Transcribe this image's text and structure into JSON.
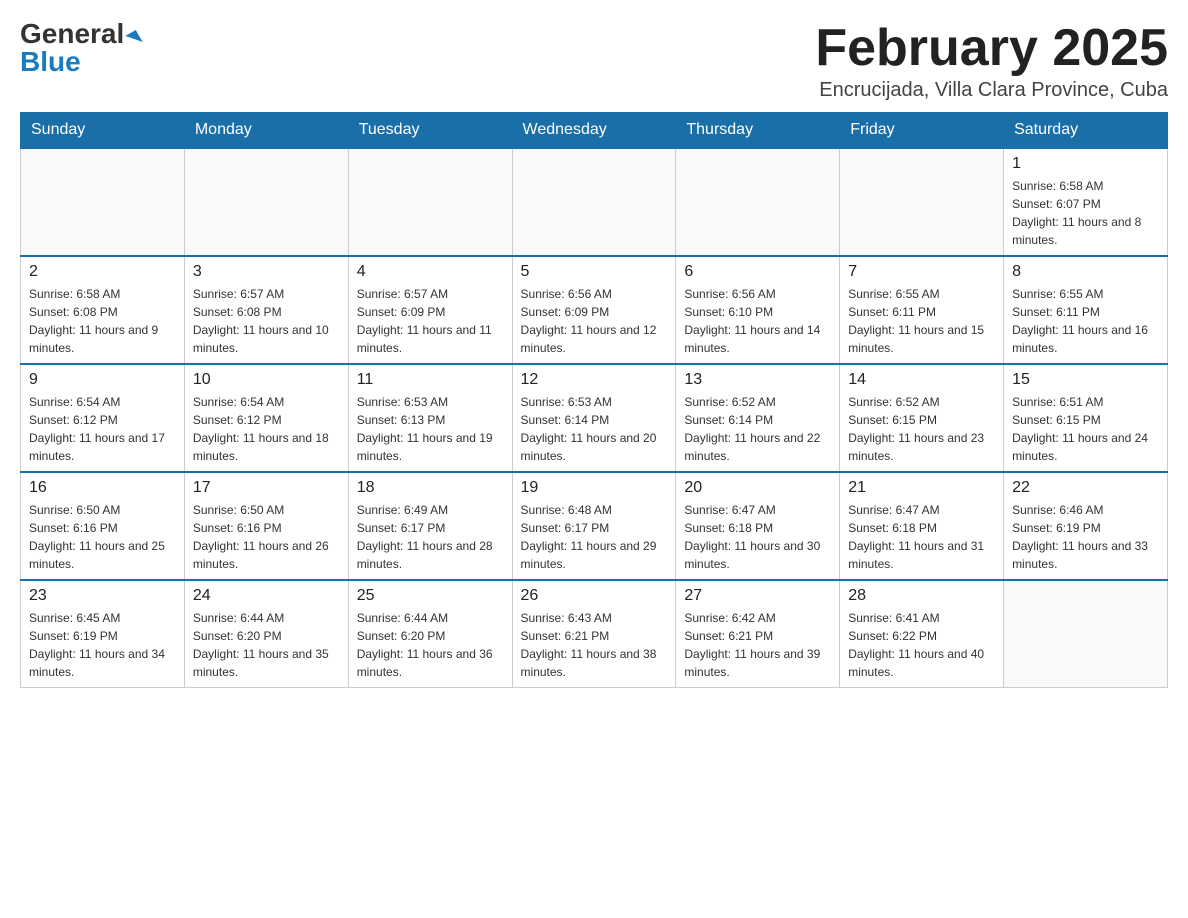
{
  "header": {
    "logo_general": "General",
    "logo_blue": "Blue",
    "month_title": "February 2025",
    "location": "Encrucijada, Villa Clara Province, Cuba"
  },
  "weekdays": [
    "Sunday",
    "Monday",
    "Tuesday",
    "Wednesday",
    "Thursday",
    "Friday",
    "Saturday"
  ],
  "weeks": [
    [
      {
        "day": "",
        "sunrise": "",
        "sunset": "",
        "daylight": ""
      },
      {
        "day": "",
        "sunrise": "",
        "sunset": "",
        "daylight": ""
      },
      {
        "day": "",
        "sunrise": "",
        "sunset": "",
        "daylight": ""
      },
      {
        "day": "",
        "sunrise": "",
        "sunset": "",
        "daylight": ""
      },
      {
        "day": "",
        "sunrise": "",
        "sunset": "",
        "daylight": ""
      },
      {
        "day": "",
        "sunrise": "",
        "sunset": "",
        "daylight": ""
      },
      {
        "day": "1",
        "sunrise": "Sunrise: 6:58 AM",
        "sunset": "Sunset: 6:07 PM",
        "daylight": "Daylight: 11 hours and 8 minutes."
      }
    ],
    [
      {
        "day": "2",
        "sunrise": "Sunrise: 6:58 AM",
        "sunset": "Sunset: 6:08 PM",
        "daylight": "Daylight: 11 hours and 9 minutes."
      },
      {
        "day": "3",
        "sunrise": "Sunrise: 6:57 AM",
        "sunset": "Sunset: 6:08 PM",
        "daylight": "Daylight: 11 hours and 10 minutes."
      },
      {
        "day": "4",
        "sunrise": "Sunrise: 6:57 AM",
        "sunset": "Sunset: 6:09 PM",
        "daylight": "Daylight: 11 hours and 11 minutes."
      },
      {
        "day": "5",
        "sunrise": "Sunrise: 6:56 AM",
        "sunset": "Sunset: 6:09 PM",
        "daylight": "Daylight: 11 hours and 12 minutes."
      },
      {
        "day": "6",
        "sunrise": "Sunrise: 6:56 AM",
        "sunset": "Sunset: 6:10 PM",
        "daylight": "Daylight: 11 hours and 14 minutes."
      },
      {
        "day": "7",
        "sunrise": "Sunrise: 6:55 AM",
        "sunset": "Sunset: 6:11 PM",
        "daylight": "Daylight: 11 hours and 15 minutes."
      },
      {
        "day": "8",
        "sunrise": "Sunrise: 6:55 AM",
        "sunset": "Sunset: 6:11 PM",
        "daylight": "Daylight: 11 hours and 16 minutes."
      }
    ],
    [
      {
        "day": "9",
        "sunrise": "Sunrise: 6:54 AM",
        "sunset": "Sunset: 6:12 PM",
        "daylight": "Daylight: 11 hours and 17 minutes."
      },
      {
        "day": "10",
        "sunrise": "Sunrise: 6:54 AM",
        "sunset": "Sunset: 6:12 PM",
        "daylight": "Daylight: 11 hours and 18 minutes."
      },
      {
        "day": "11",
        "sunrise": "Sunrise: 6:53 AM",
        "sunset": "Sunset: 6:13 PM",
        "daylight": "Daylight: 11 hours and 19 minutes."
      },
      {
        "day": "12",
        "sunrise": "Sunrise: 6:53 AM",
        "sunset": "Sunset: 6:14 PM",
        "daylight": "Daylight: 11 hours and 20 minutes."
      },
      {
        "day": "13",
        "sunrise": "Sunrise: 6:52 AM",
        "sunset": "Sunset: 6:14 PM",
        "daylight": "Daylight: 11 hours and 22 minutes."
      },
      {
        "day": "14",
        "sunrise": "Sunrise: 6:52 AM",
        "sunset": "Sunset: 6:15 PM",
        "daylight": "Daylight: 11 hours and 23 minutes."
      },
      {
        "day": "15",
        "sunrise": "Sunrise: 6:51 AM",
        "sunset": "Sunset: 6:15 PM",
        "daylight": "Daylight: 11 hours and 24 minutes."
      }
    ],
    [
      {
        "day": "16",
        "sunrise": "Sunrise: 6:50 AM",
        "sunset": "Sunset: 6:16 PM",
        "daylight": "Daylight: 11 hours and 25 minutes."
      },
      {
        "day": "17",
        "sunrise": "Sunrise: 6:50 AM",
        "sunset": "Sunset: 6:16 PM",
        "daylight": "Daylight: 11 hours and 26 minutes."
      },
      {
        "day": "18",
        "sunrise": "Sunrise: 6:49 AM",
        "sunset": "Sunset: 6:17 PM",
        "daylight": "Daylight: 11 hours and 28 minutes."
      },
      {
        "day": "19",
        "sunrise": "Sunrise: 6:48 AM",
        "sunset": "Sunset: 6:17 PM",
        "daylight": "Daylight: 11 hours and 29 minutes."
      },
      {
        "day": "20",
        "sunrise": "Sunrise: 6:47 AM",
        "sunset": "Sunset: 6:18 PM",
        "daylight": "Daylight: 11 hours and 30 minutes."
      },
      {
        "day": "21",
        "sunrise": "Sunrise: 6:47 AM",
        "sunset": "Sunset: 6:18 PM",
        "daylight": "Daylight: 11 hours and 31 minutes."
      },
      {
        "day": "22",
        "sunrise": "Sunrise: 6:46 AM",
        "sunset": "Sunset: 6:19 PM",
        "daylight": "Daylight: 11 hours and 33 minutes."
      }
    ],
    [
      {
        "day": "23",
        "sunrise": "Sunrise: 6:45 AM",
        "sunset": "Sunset: 6:19 PM",
        "daylight": "Daylight: 11 hours and 34 minutes."
      },
      {
        "day": "24",
        "sunrise": "Sunrise: 6:44 AM",
        "sunset": "Sunset: 6:20 PM",
        "daylight": "Daylight: 11 hours and 35 minutes."
      },
      {
        "day": "25",
        "sunrise": "Sunrise: 6:44 AM",
        "sunset": "Sunset: 6:20 PM",
        "daylight": "Daylight: 11 hours and 36 minutes."
      },
      {
        "day": "26",
        "sunrise": "Sunrise: 6:43 AM",
        "sunset": "Sunset: 6:21 PM",
        "daylight": "Daylight: 11 hours and 38 minutes."
      },
      {
        "day": "27",
        "sunrise": "Sunrise: 6:42 AM",
        "sunset": "Sunset: 6:21 PM",
        "daylight": "Daylight: 11 hours and 39 minutes."
      },
      {
        "day": "28",
        "sunrise": "Sunrise: 6:41 AM",
        "sunset": "Sunset: 6:22 PM",
        "daylight": "Daylight: 11 hours and 40 minutes."
      },
      {
        "day": "",
        "sunrise": "",
        "sunset": "",
        "daylight": ""
      }
    ]
  ]
}
